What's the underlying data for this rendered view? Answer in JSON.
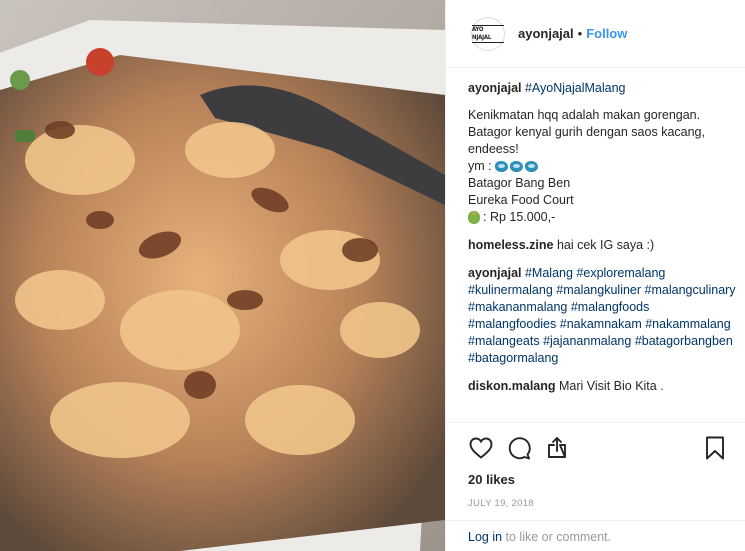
{
  "post": {
    "username": "ayonjajal",
    "avatar_text": "AYO NJAJAL",
    "separator": "•",
    "follow_label": "Follow",
    "image_alt": "Batagor with peanut sauce and fried shallots in a paper tray"
  },
  "caption": {
    "username": "ayonjajal",
    "hashtag": "#AyoNjajalMalang",
    "line1": "Kenikmatan hqq adalah makan gorengan.",
    "line2": "Batagor kenyal gurih dengan saos kacang,",
    "line3": "endeess!",
    "ym_label": "ym : ",
    "place": "Batagor Bang Ben",
    "location": "Eureka Food Court",
    "price": ": Rp 15.000,-"
  },
  "comments": [
    {
      "username": "homeless.zine",
      "text": "hai cek IG saya :)"
    },
    {
      "username": "ayonjajal",
      "tags": [
        "#Malang",
        "#exploremalang",
        "#kulinermalang",
        "#malangkuliner",
        "#malangculinary",
        "#makananmalang",
        "#malangfoods",
        "#malangfoodies",
        "#nakamnakam",
        "#nakammalang",
        "#malangeats",
        "#jajananmalang",
        "#batagorbangben",
        "#batagormalang"
      ]
    },
    {
      "username": "diskon.malang",
      "text": "Mari Visit Bio Kita ."
    }
  ],
  "actions": {
    "icons": [
      "heart-icon",
      "comment-icon",
      "share-icon",
      "bookmark-icon"
    ],
    "likes": "20 likes",
    "date": "JULY 19, 2018"
  },
  "login": {
    "link": "Log in",
    "text": " to like or comment."
  },
  "colors": {
    "link": "#003569",
    "follow": "#3897f0",
    "muted": "#999999"
  }
}
